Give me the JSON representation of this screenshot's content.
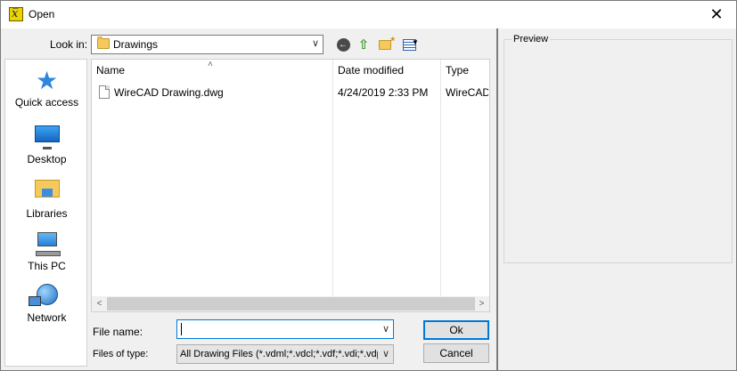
{
  "window": {
    "title": "Open",
    "icon_glyph": "x̅",
    "close_glyph": "✕"
  },
  "toolbar": {
    "look_in_label": "Look in:",
    "look_in_value": "Drawings",
    "combo_arrow": "∨",
    "back_glyph": "←",
    "up_glyph": "⇧",
    "views_arrow": "▼"
  },
  "places": [
    {
      "label": "Quick access",
      "icon": "star-icon"
    },
    {
      "label": "Desktop",
      "icon": "desktop-icon"
    },
    {
      "label": "Libraries",
      "icon": "libraries-icon"
    },
    {
      "label": "This PC",
      "icon": "computer-icon"
    },
    {
      "label": "Network",
      "icon": "network-icon"
    }
  ],
  "file_list": {
    "columns": [
      "Name",
      "Date modified",
      "Type"
    ],
    "sort_arrow": "˄",
    "rows": [
      {
        "name": "WireCAD Drawing.dwg",
        "date_modified": "4/24/2019 2:33 PM",
        "type": "WireCAD"
      }
    ],
    "scroll_left": "<",
    "scroll_right": ">"
  },
  "form": {
    "file_name_label": "File name:",
    "file_name_value": "",
    "files_of_type_label": "Files of type:",
    "files_of_type_value": "All Drawing Files (*.vdml;*.vdcl;*.vdf;*.vdi;*.vdp;",
    "ok_label": "Ok",
    "cancel_label": "Cancel"
  },
  "preview": {
    "label": "Preview"
  },
  "colors": {
    "accent": "#0078d7",
    "window_bg": "#f0f0f0",
    "folder": "#f5c95c"
  }
}
